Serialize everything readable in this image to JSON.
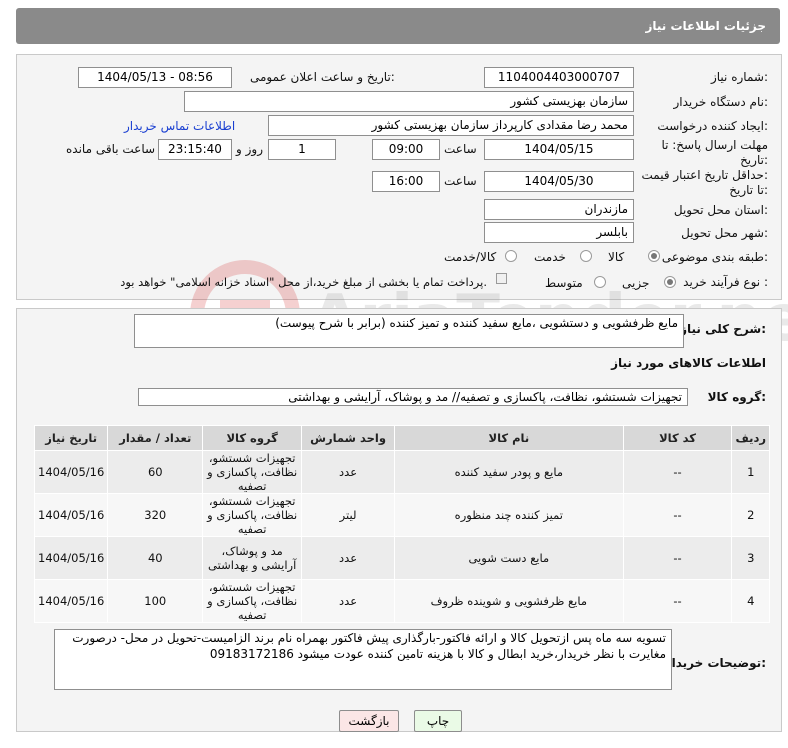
{
  "header": {
    "title": "جزئیات اطلاعات نیاز"
  },
  "form": {
    "need_number_label": "شماره نیاز:",
    "need_number": "1104004403000707",
    "announce_label": "تاریخ و ساعت اعلان عمومی:",
    "announce_value": "1404/05/13 - 08:56",
    "buyer_org_label": "نام دستگاه خریدار:",
    "buyer_org": "سازمان بهزیستی کشور",
    "creator_label": "ایجاد کننده درخواست:",
    "creator": "محمد رضا  مقدادی کارپرداز سازمان بهزیستی کشور",
    "contact_link": "اطلاعات تماس خریدار",
    "deadline_label_1": "مهلت ارسال پاسخ: تا",
    "deadline_label_2": "تاریخ:",
    "deadline_date": "1404/05/15",
    "time_label": "ساعت",
    "deadline_time": "09:00",
    "days_value": "1",
    "days_label": "روز و",
    "remaining_value": "23:15:40",
    "remaining_label": "ساعت باقی مانده",
    "validity_label_1": "حداقل تاریخ اعتبار قیمت:",
    "validity_label_2": "تا تاریخ:",
    "validity_date": "1404/05/30",
    "validity_time": "16:00",
    "province_label": "استان محل تحویل:",
    "province": "مازندران",
    "city_label": "شهر محل تحویل:",
    "city": "بابلسر",
    "category_label": "طبقه بندی موضوعی:",
    "category_options": [
      "کالا",
      "خدمت",
      "کالا/خدمت"
    ],
    "category_selected": "کالا",
    "process_label": "نوع فرآیند خرید :",
    "process_options": [
      "جزیی",
      "متوسط"
    ],
    "process_selected": "جزیی",
    "payment_note": "پرداخت تمام یا بخشی از مبلغ خرید،از محل \"اسناد خزانه اسلامی\" خواهد بود."
  },
  "description": {
    "label": "شرح کلی نیاز:",
    "text": "مایع ظرفشویی و دستشویی ،مایع سفید کننده و تمیز کننده (برابر با شرح پیوست)"
  },
  "goods_section": {
    "title": "اطلاعات کالاهای مورد نیاز",
    "group_label": "گروه کالا:",
    "group_value": "تجهیزات شستشو، نظافت، پاکسازی و تصفیه// مد و پوشاک، آرایشی و بهداشتی"
  },
  "table": {
    "headers": [
      "ردیف",
      "کد کالا",
      "نام کالا",
      "واحد شمارش",
      "گروه کالا",
      "تعداد / مقدار",
      "تاریخ نیاز"
    ],
    "rows": [
      [
        "1",
        "--",
        "مایع و پودر سفید کننده",
        "عدد",
        "تجهیزات شستشو، نظافت، پاکسازی و تصفیه",
        "60",
        "1404/05/16"
      ],
      [
        "2",
        "--",
        "تمیز کننده چند منظوره",
        "لیتر",
        "تجهیزات شستشو، نظافت، پاکسازی و تصفیه",
        "320",
        "1404/05/16"
      ],
      [
        "3",
        "--",
        "مایع دست شویی",
        "عدد",
        "مد و پوشاک، آرایشی و بهداشتی",
        "40",
        "1404/05/16"
      ],
      [
        "4",
        "--",
        "مایع ظرفشویی و شوینده ظروف",
        "عدد",
        "تجهیزات شستشو، نظافت، پاکسازی و تصفیه",
        "100",
        "1404/05/16"
      ]
    ]
  },
  "buyer_notes": {
    "label": "توضیحات خریدار:",
    "text": "تسویه سه ماه پس ازتحویل کالا و ارائه فاکتور-بارگذاری پیش فاکتور بهمراه نام برند الزامیست-تحویل در محل- درصورت مغایرت با نظر خریدار،خرید ابطال و کالا با  هزینه تامین کننده عودت میشود 09183172186"
  },
  "buttons": {
    "print": "چاپ",
    "back": "بازگشت"
  },
  "colors": {
    "header_bg": "#8a8a8a",
    "link": "#1a3fd1",
    "print_btn": "#eafae6",
    "back_btn": "#fbe6e6"
  }
}
